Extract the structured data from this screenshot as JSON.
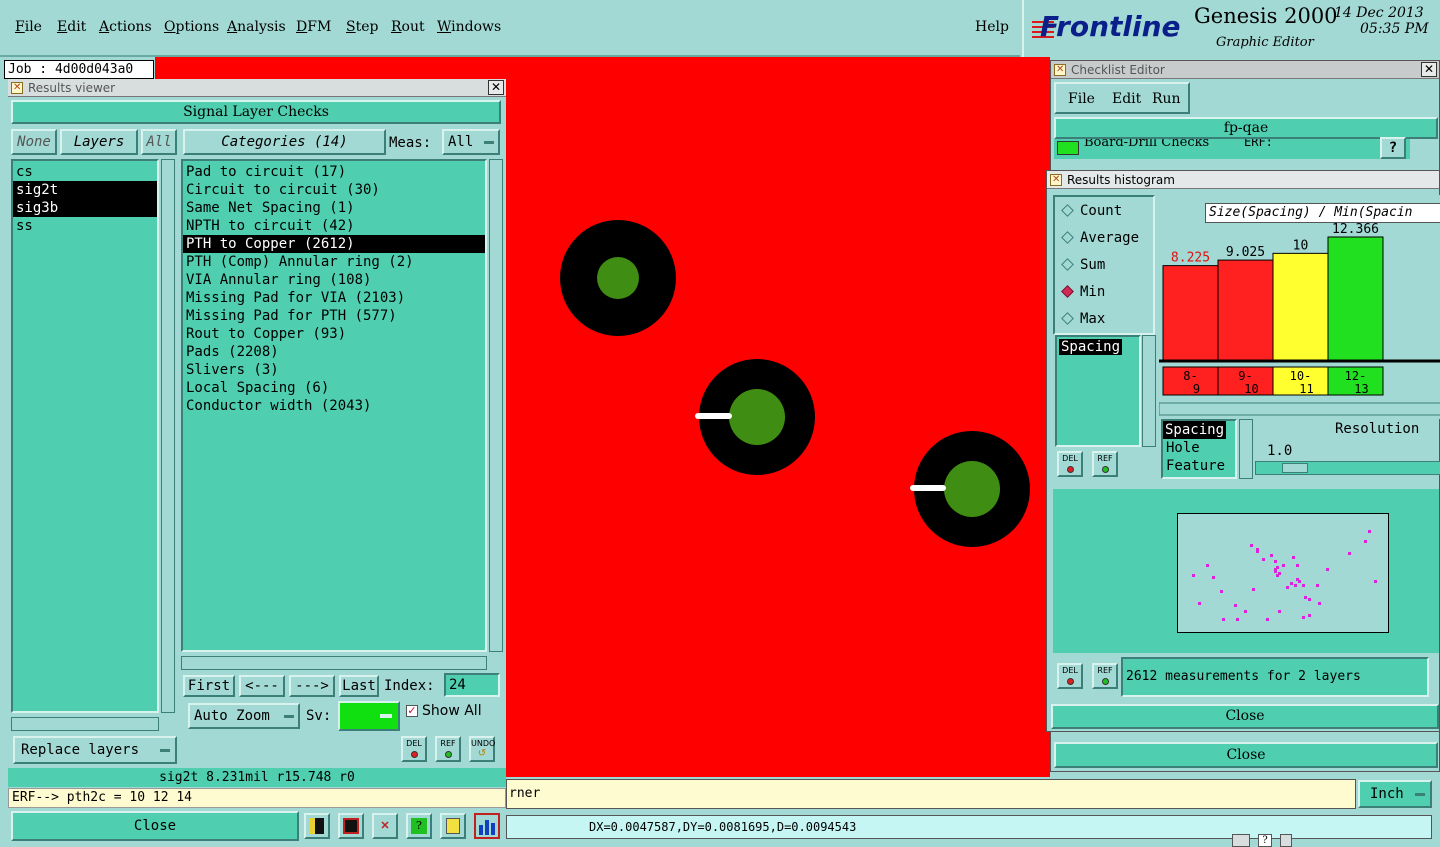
{
  "menubar": {
    "items": [
      {
        "label": "File",
        "u": "F"
      },
      {
        "label": "Edit",
        "u": "E"
      },
      {
        "label": "Actions",
        "u": "A"
      },
      {
        "label": "Options",
        "u": "O"
      },
      {
        "label": "Analysis",
        "u": "A"
      },
      {
        "label": "DFM",
        "u": "D"
      },
      {
        "label": "Step",
        "u": "S"
      },
      {
        "label": "Rout",
        "u": "R"
      },
      {
        "label": "Windows",
        "u": "W"
      }
    ],
    "help": "Help"
  },
  "branding": {
    "logo": "Frontline",
    "product": "Genesis 2000",
    "subtitle": "Graphic Editor",
    "date": "14 Dec 2013",
    "time": "05:35 PM"
  },
  "job": "Job : 4d00d043a0",
  "results_viewer": {
    "title": "Results viewer",
    "header": "Signal Layer Checks",
    "none_btn": "None",
    "layers_btn": "Layers",
    "all_btn": "All",
    "layers": [
      {
        "name": "cs",
        "selected": false
      },
      {
        "name": "sig2t",
        "selected": true
      },
      {
        "name": "sig3b",
        "selected": true
      },
      {
        "name": "ss",
        "selected": false
      }
    ],
    "categories_btn": "Categories (14)",
    "meas_label": "Meas:",
    "meas_value": "All",
    "categories": [
      {
        "label": "Pad to circuit (17)",
        "selected": false
      },
      {
        "label": "Circuit to circuit (30)",
        "selected": false
      },
      {
        "label": "Same Net Spacing (1)",
        "selected": false
      },
      {
        "label": "NPTH to circuit (42)",
        "selected": false
      },
      {
        "label": "PTH to Copper (2612)",
        "selected": true
      },
      {
        "label": "PTH (Comp) Annular ring (2)",
        "selected": false
      },
      {
        "label": "VIA Annular ring (108)",
        "selected": false
      },
      {
        "label": "Missing Pad for VIA (2103)",
        "selected": false
      },
      {
        "label": "Missing Pad for PTH (577)",
        "selected": false
      },
      {
        "label": "Rout to Copper (93)",
        "selected": false
      },
      {
        "label": "Pads (2208)",
        "selected": false
      },
      {
        "label": "Slivers (3)",
        "selected": false
      },
      {
        "label": "Local Spacing (6)",
        "selected": false
      },
      {
        "label": "Conductor width (2043)",
        "selected": false
      }
    ],
    "nav": {
      "first": "First",
      "prev": "<---",
      "next": "--->",
      "last": "Last",
      "index_label": "Index:",
      "index_value": "24"
    },
    "auto_zoom": "Auto Zoom",
    "sv_label": "Sv:",
    "show_all": "Show All",
    "del": "DEL",
    "ref": "REF",
    "undo": "UNDO",
    "replace_layers": "Replace layers",
    "status": "sig2t 8.231mil  r15.748  r0",
    "erf": "ERF--> pth2c = 10 12 14",
    "close": "Close"
  },
  "checklist_editor": {
    "title": "Checklist Editor",
    "menu": [
      "File",
      "Edit",
      "Run"
    ],
    "name": "fp-qae",
    "row": "Board-Drill Checks",
    "erf": "ERF:",
    "close": "Close"
  },
  "histogram": {
    "title": "Results histogram",
    "radios": [
      {
        "label": "Count",
        "on": false
      },
      {
        "label": "Average",
        "on": false
      },
      {
        "label": "Sum",
        "on": false
      },
      {
        "label": "Min",
        "on": true
      },
      {
        "label": "Max",
        "on": false
      }
    ],
    "list_item": "Spacing",
    "formula": "Size(Spacing) / Min(Spacin",
    "chart_data": {
      "type": "bar",
      "categories": [
        "8-9",
        "9-10",
        "10-11",
        "12-13"
      ],
      "values": [
        8.225,
        9.025,
        10,
        12.366
      ],
      "value_labels": [
        "8.225",
        "9.025",
        "10",
        "12.366"
      ],
      "colors": [
        "#ff2020",
        "#ff2020",
        "#ffff30",
        "#20e020"
      ],
      "label_colors": [
        "#e01010",
        "#000000",
        "#000000",
        "#000000"
      ],
      "bins": [
        {
          "a": "8-",
          "b": "9"
        },
        {
          "a": "9-",
          "b": "10"
        },
        {
          "a": "10-",
          "b": "11"
        },
        {
          "a": "12-",
          "b": "13"
        }
      ]
    },
    "attrs": [
      "Spacing",
      "Hole",
      "Feature"
    ],
    "resolution_label": "Resolution",
    "resolution_value": "1.0",
    "measurements": "2612 measurements for 2 layers",
    "close": "Close"
  },
  "bottom": {
    "text": "rner",
    "unit": "Inch",
    "coords": "DX=0.0047587,DY=0.0081695,D=0.0094543"
  }
}
